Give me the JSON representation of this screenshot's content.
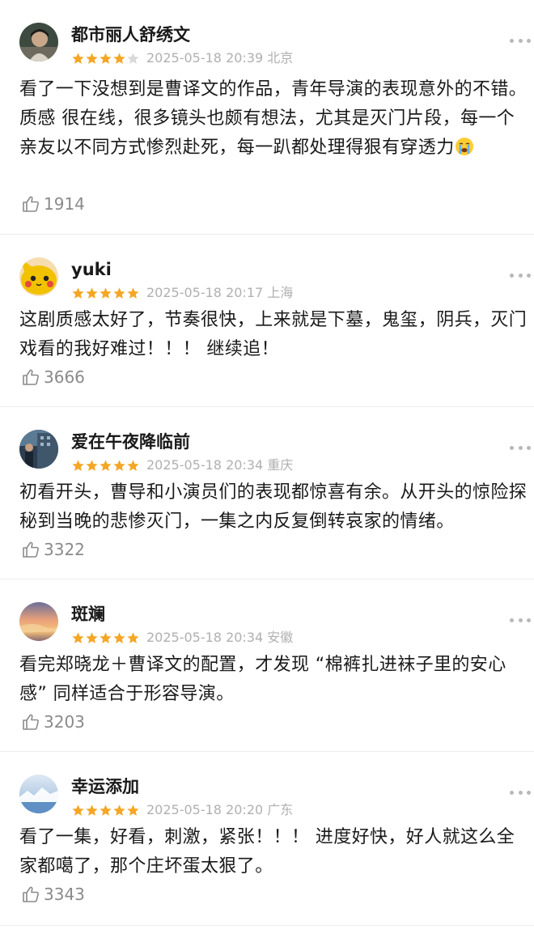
{
  "reviews": [
    {
      "username": "都市丽人舒绣文",
      "rating": 4,
      "date": "2025-05-18 20:39",
      "location": "北京",
      "content": "看了一下没想到是曹译文的作品，青年导演的表现意外的不错。质感 很在线，很多镜头也颇有想法，尤其是灭门片段，每一个亲友以不同方式惨烈赴死，每一趴都处理得狠有穿透力",
      "emoji": "crying-face-emoji",
      "likes": "1914"
    },
    {
      "username": "yuki",
      "rating": 5,
      "date": "2025-05-18 20:17",
      "location": "上海",
      "content": "这剧质感太好了，节奏很快，上来就是下墓，鬼玺，阴兵，灭门戏看的我好难过！！！ 继续追！",
      "likes": "3666"
    },
    {
      "username": "爱在午夜降临前",
      "rating": 5,
      "date": "2025-05-18 20:34",
      "location": "重庆",
      "content": "初看开头，曹导和小演员们的表现都惊喜有余。从开头的惊险探秘到当晚的悲惨灭门，一集之内反复倒转哀家的情绪。",
      "likes": "3322"
    },
    {
      "username": "斑斓",
      "rating": 5,
      "date": "2025-05-18 20:34",
      "location": "安徽",
      "content": "看完郑晓龙＋曹译文的配置，才发现 “棉裤扎进袜子里的安心感” 同样适合于形容导演。",
      "likes": "3203"
    },
    {
      "username": "幸运添加",
      "rating": 5,
      "date": "2025-05-18 20:20",
      "location": "广东",
      "content": "看了一集，好看，刺激，紧张！！！ 进度好快，好人就这么全家都噶了，那个庄坏蛋太狠了。",
      "likes": "3343"
    }
  ],
  "colors": {
    "star_filled": "#f5a623",
    "star_empty": "#d9d9d9",
    "meta_text": "#b0b0b0",
    "like_text": "#8a8a8a"
  },
  "icons": {
    "like": "thumbs-up-icon",
    "more": "more-dots-icon",
    "star": "star-icon"
  }
}
